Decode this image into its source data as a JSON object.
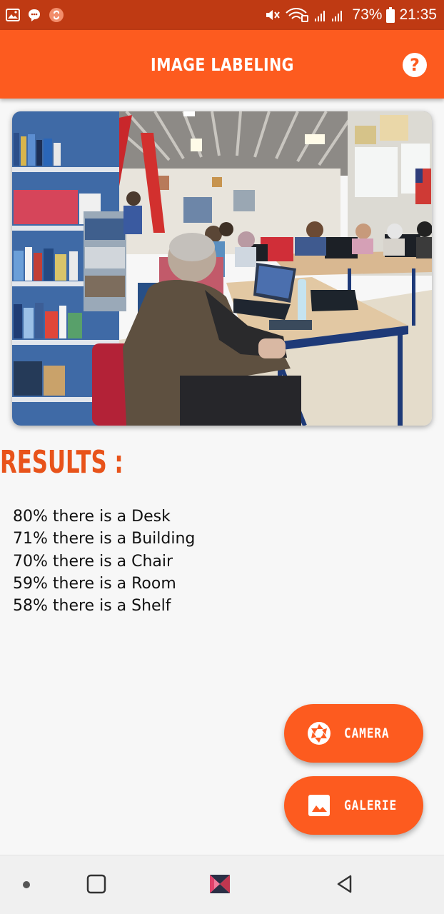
{
  "status_bar": {
    "battery": "73%",
    "time": "21:35"
  },
  "app_bar": {
    "title": "IMAGE LABELING",
    "help_icon": "question-circle-icon",
    "help_glyph": "?"
  },
  "photo": {
    "description_icon": "classroom-photo"
  },
  "results": {
    "heading": "RESULTS :",
    "items": [
      "80% there is a Desk",
      "71% there is a Building",
      "70% there is a Chair",
      "59% there is a Room",
      "58% there is a Shelf"
    ]
  },
  "actions": {
    "camera_label": "CAMERA",
    "camera_icon": "shutter-icon",
    "gallery_label": "GALERIE",
    "gallery_icon": "image-icon"
  },
  "nav": {
    "dot_icon": "dot-icon",
    "recents_icon": "square-icon",
    "home_icon": "bowtie-icon",
    "back_icon": "triangle-back-icon"
  },
  "colors": {
    "status_bar": "#bf3a13",
    "primary": "#fd5b1f",
    "heading": "#e8531a",
    "background": "#f7f7f7"
  }
}
